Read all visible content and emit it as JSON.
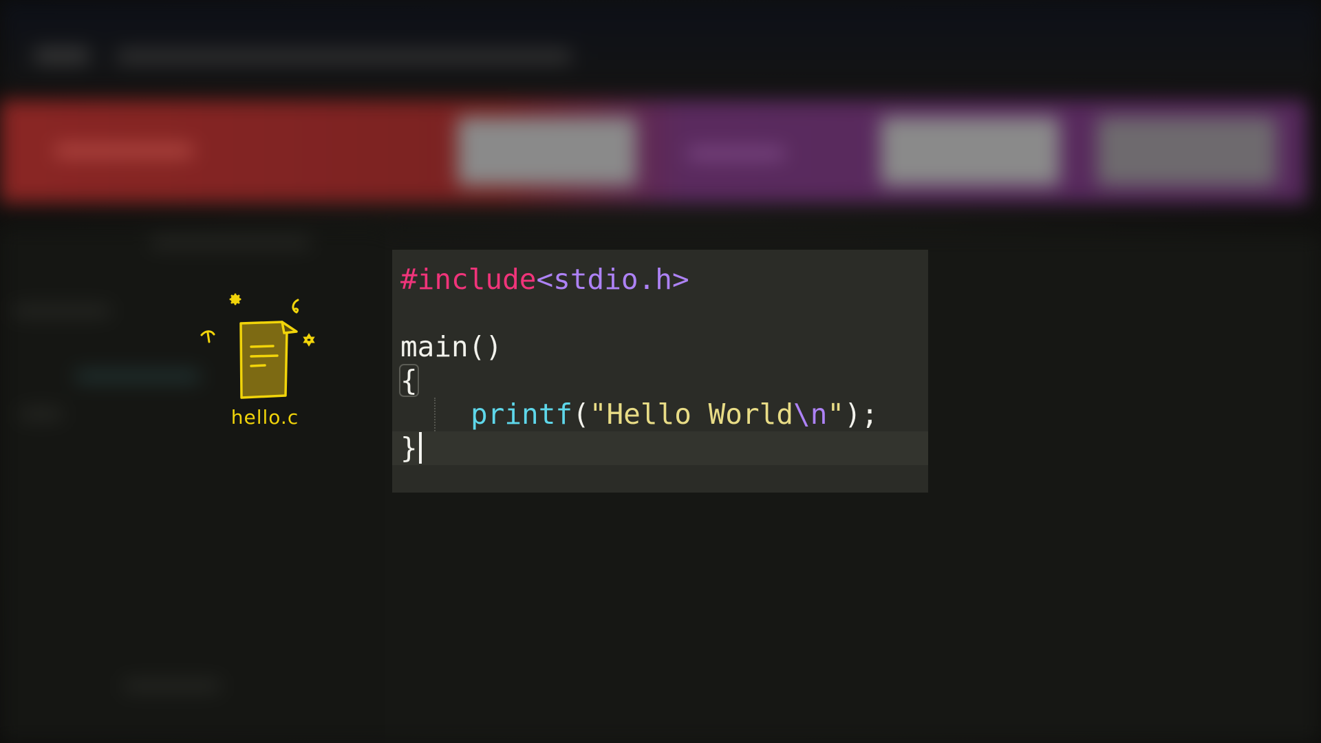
{
  "file": {
    "name": "hello.c",
    "icon": "document-icon",
    "doodle_color": "#f1d40a"
  },
  "editor": {
    "background": "#2b2c27",
    "lines": [
      {
        "tokens": [
          {
            "text": "#include",
            "kind": "directive"
          },
          {
            "text": "<stdio.h>",
            "kind": "header"
          }
        ]
      },
      {
        "tokens": []
      },
      {
        "tokens": [
          {
            "text": "main()",
            "kind": "plain"
          }
        ]
      },
      {
        "tokens": [
          {
            "text": "{",
            "kind": "brace"
          }
        ]
      },
      {
        "tokens": [
          {
            "text": "printf",
            "kind": "func"
          },
          {
            "text": "(",
            "kind": "plain"
          },
          {
            "text": "\"Hello World",
            "kind": "string"
          },
          {
            "text": "\\n",
            "kind": "escape"
          },
          {
            "text": "\"",
            "kind": "string"
          },
          {
            "text": ");",
            "kind": "plain"
          }
        ]
      },
      {
        "tokens": [
          {
            "text": "}",
            "kind": "plain"
          }
        ]
      }
    ],
    "colors": {
      "directive": "#f0347a",
      "header": "#ad82f5",
      "func": "#5ed7ea",
      "string": "#e8dc86",
      "escape": "#ad82f5",
      "plain": "#f2f2ec"
    }
  }
}
